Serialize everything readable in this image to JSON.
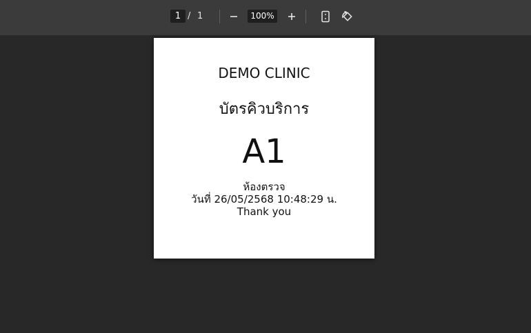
{
  "toolbar": {
    "page_current": "1",
    "page_separator": "/",
    "page_total": "1",
    "zoom_out_icon": "minus-icon",
    "zoom_level": "100%",
    "zoom_in_icon": "plus-icon",
    "fit_icon": "fit-page-icon",
    "rotate_icon": "rotate-icon"
  },
  "document": {
    "clinic_name": "DEMO CLINIC",
    "ticket_title": "บัตรคิวบริการ",
    "queue_number": "A1",
    "room": "ห้องตรวจ",
    "datetime": "วันที่ 26/05/2568 10:48:29 น.",
    "thanks": "Thank you"
  },
  "colors": {
    "toolbar_bg": "#3b3b3b",
    "viewer_bg": "#282828",
    "paper_bg": "#ffffff"
  }
}
